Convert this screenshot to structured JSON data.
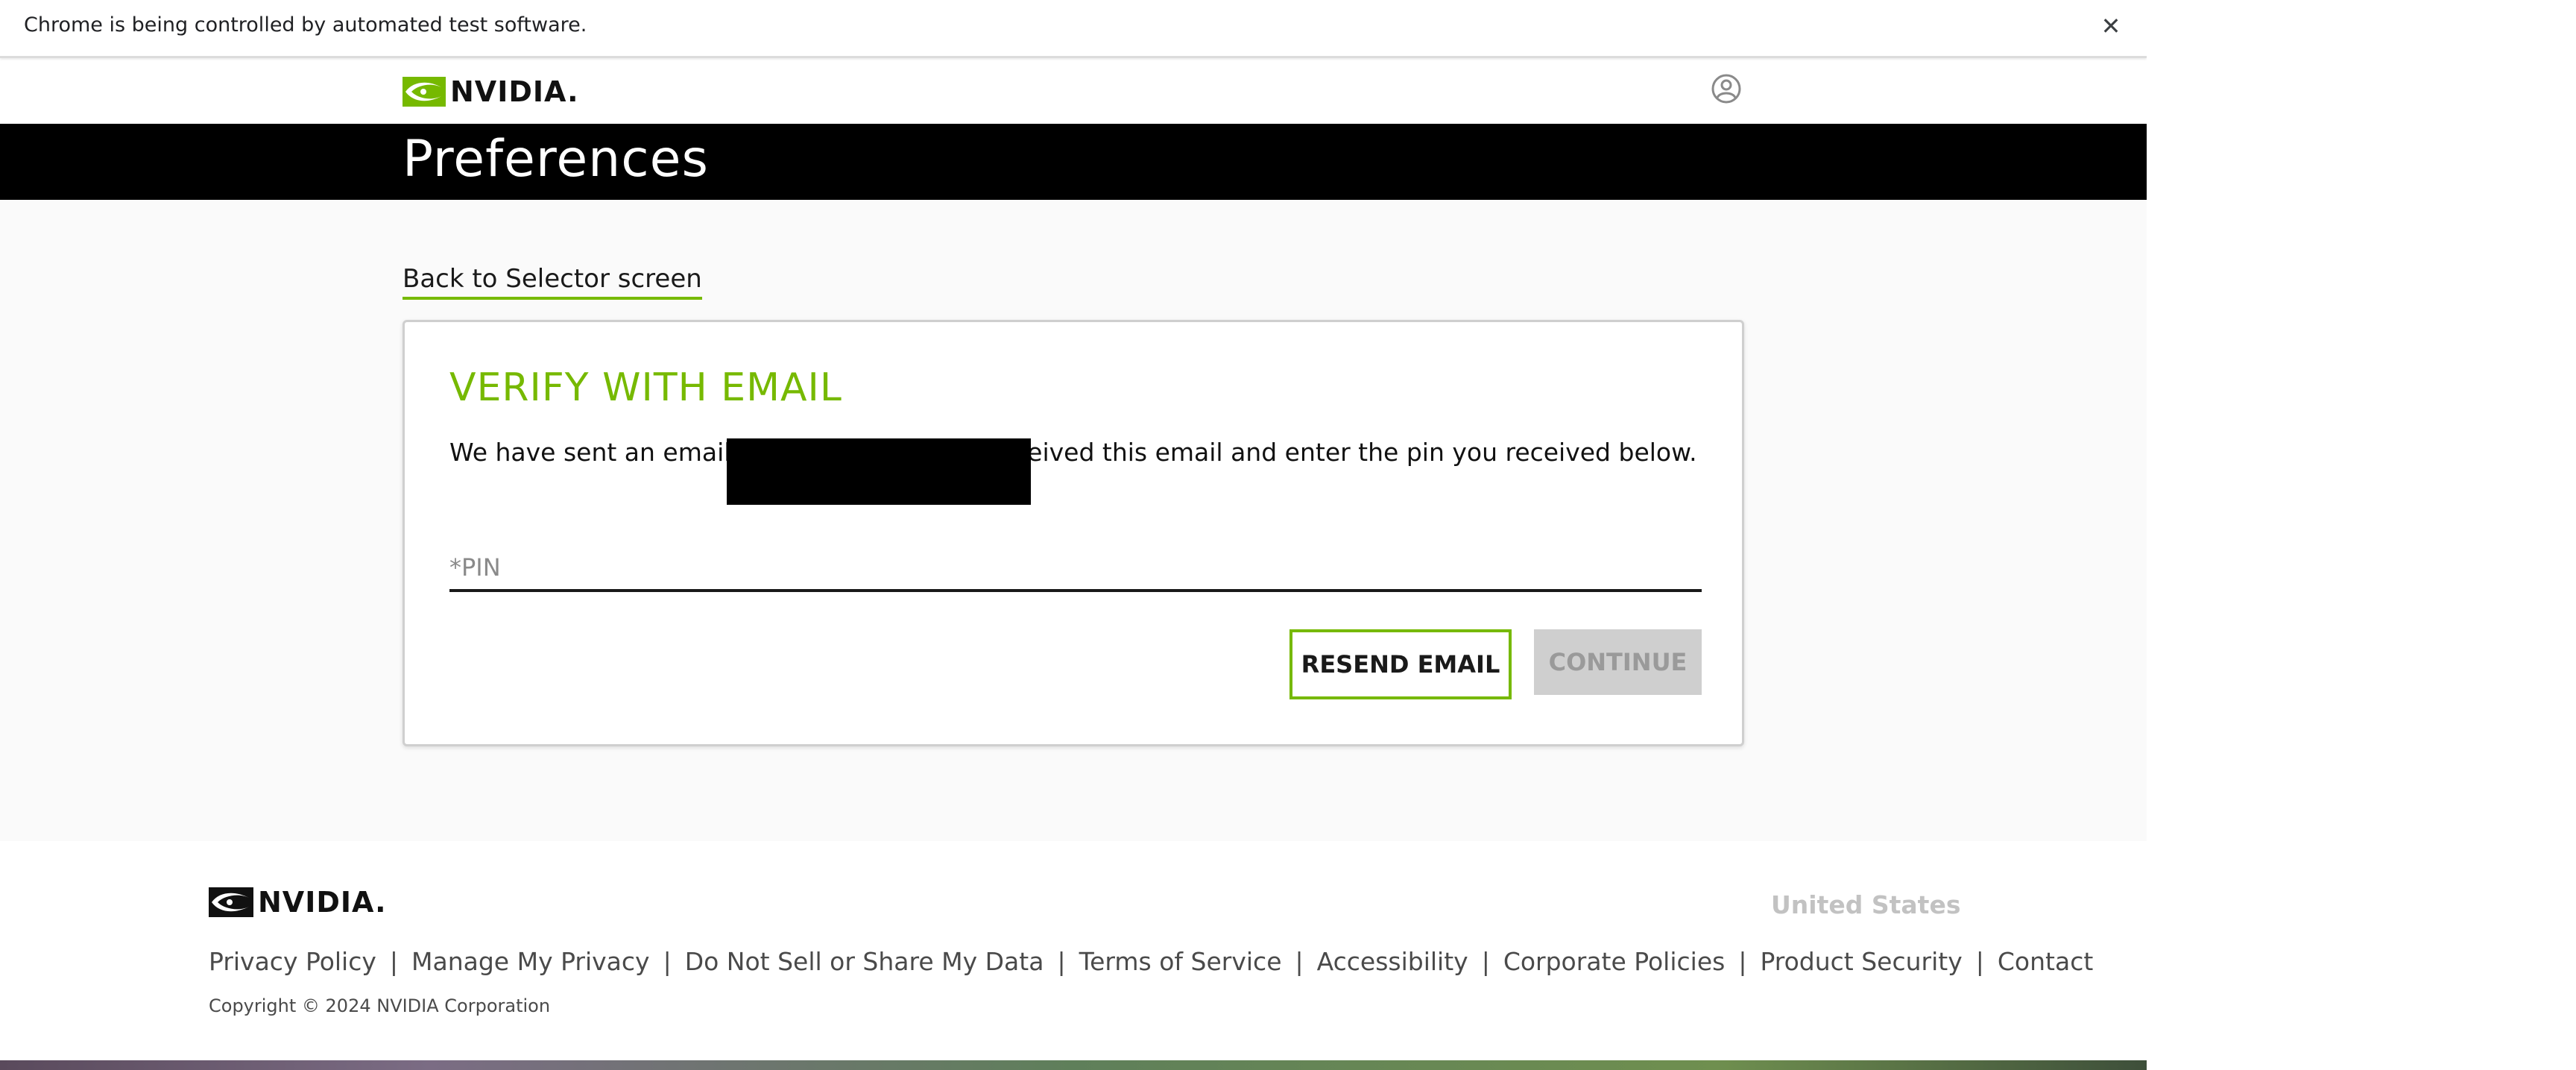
{
  "infobar": {
    "message": "Chrome is being controlled by automated test software.",
    "close_glyph": "✕"
  },
  "header": {
    "logo_text": "NVIDIA.",
    "account_icon": "user-circle-icon"
  },
  "title_band": {
    "title": "Preferences"
  },
  "main": {
    "back_link": "Back to Selector screen",
    "card": {
      "heading": "VERIFY WITH EMAIL",
      "message": "We have sent an email to                         Please verify you received this email and enter the pin you received below.",
      "pin_placeholder": "*PIN",
      "pin_value": "",
      "resend_label": "RESEND EMAIL",
      "continue_label": "CONTINUE"
    }
  },
  "footer": {
    "logo_text": "NVIDIA.",
    "region": "United States",
    "links": [
      "Privacy Policy",
      "Manage My Privacy",
      "Do Not Sell or Share My Data",
      "Terms of Service",
      "Accessibility",
      "Corporate Policies",
      "Product Security",
      "Contact"
    ],
    "separator": "|",
    "copyright": "Copyright © 2024 NVIDIA Corporation"
  },
  "colors": {
    "brand_green": "#76b900",
    "title_band": "#000000",
    "disabled_button": "#cfcfcf"
  }
}
